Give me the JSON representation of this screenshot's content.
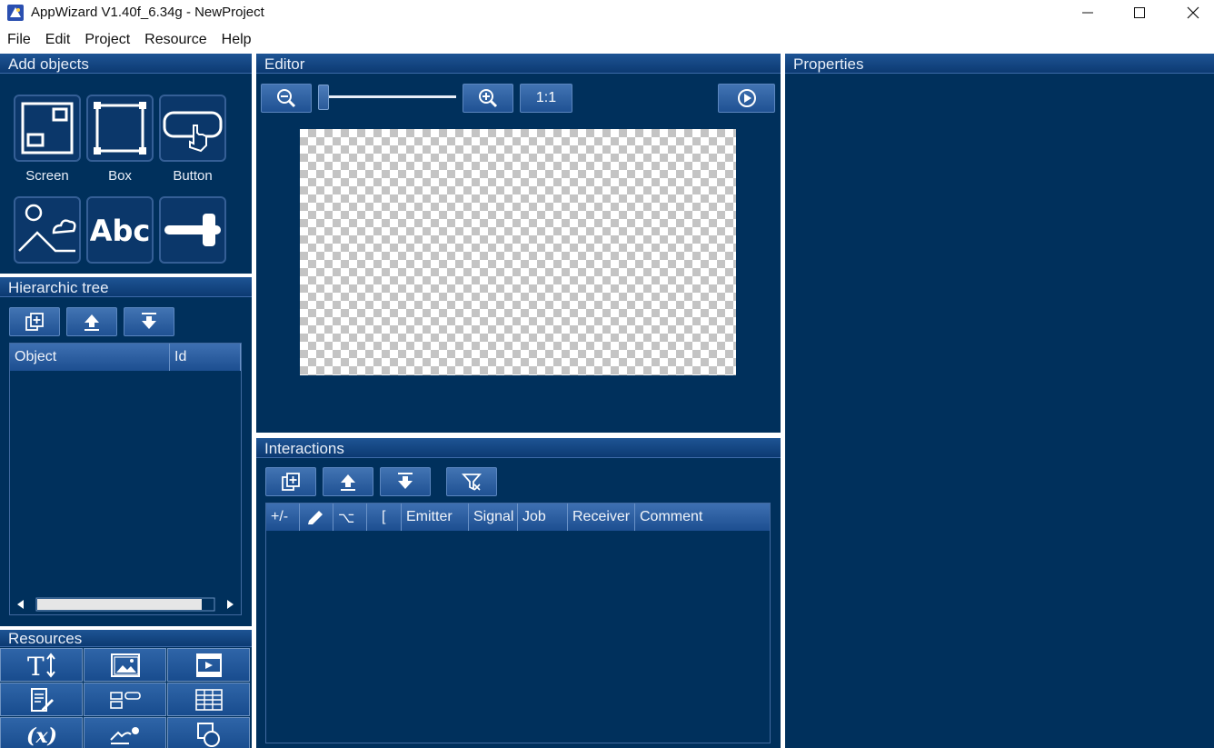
{
  "window": {
    "title": "AppWizard V1.40f_6.34g - NewProject"
  },
  "menu": [
    "File",
    "Edit",
    "Project",
    "Resource",
    "Help"
  ],
  "add_objects": {
    "title": "Add objects",
    "tools": [
      {
        "label": "Screen",
        "icon": "screen-icon"
      },
      {
        "label": "Box",
        "icon": "box-icon"
      },
      {
        "label": "Button",
        "icon": "button-icon"
      },
      {
        "label": "",
        "icon": "image-icon"
      },
      {
        "label": "",
        "icon": "text-icon"
      },
      {
        "label": "",
        "icon": "slider-icon"
      }
    ],
    "text_tool_glyph": "Abc"
  },
  "tree": {
    "title": "Hierarchic tree",
    "columns": [
      "Object",
      "Id"
    ]
  },
  "resources": {
    "title": "Resources",
    "italic_glyph": "(x)",
    "icons": [
      "font-icon",
      "image-icon",
      "movie-icon",
      "text-edit-icon",
      "variable-list-icon",
      "table-icon",
      "variable-icon",
      "curve-icon",
      "shape-icon"
    ]
  },
  "editor": {
    "title": "Editor",
    "zoom_reset_label": "1:1"
  },
  "interactions": {
    "title": "Interactions",
    "columns": [
      "+/-",
      "",
      "⌥",
      "[",
      "Emitter",
      "Signal",
      "Job",
      "Receiver",
      "Comment"
    ]
  },
  "properties": {
    "title": "Properties"
  },
  "colors": {
    "panel_bg": "#00305c",
    "header": "#1e5494",
    "button": "#2f65a8"
  }
}
